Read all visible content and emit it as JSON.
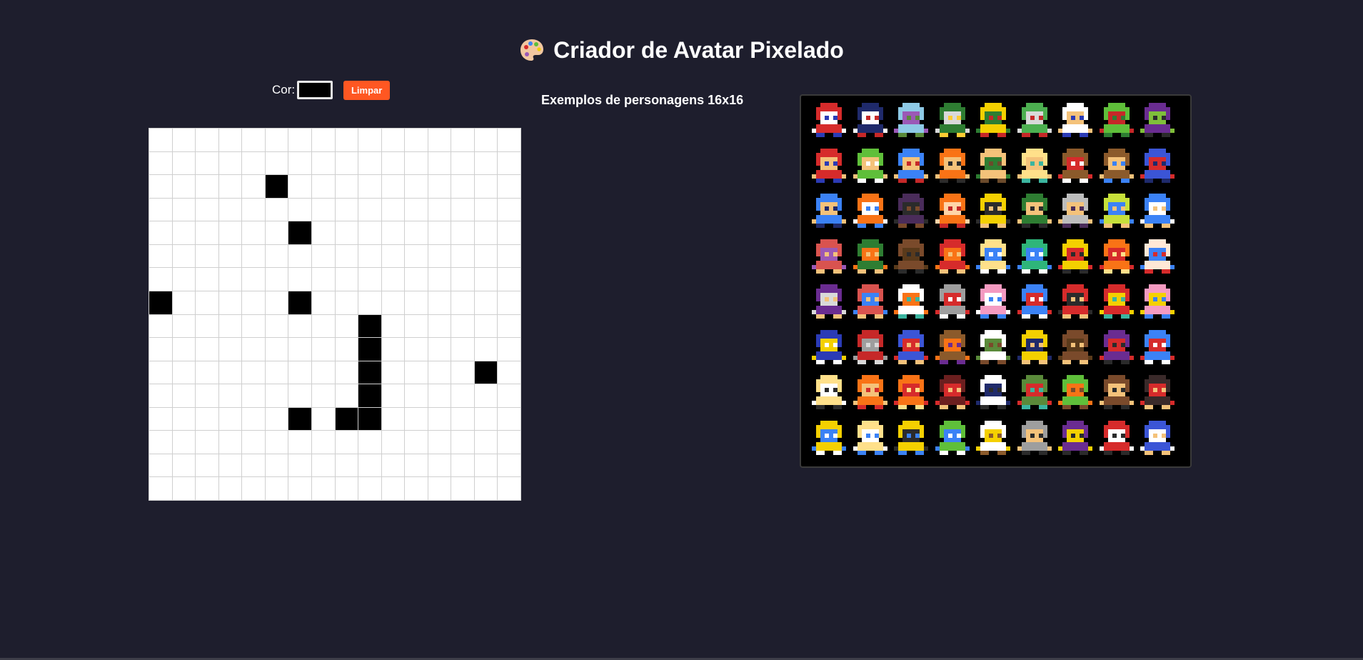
{
  "header": {
    "title": "Criador de Avatar Pixelado",
    "icon": "palette-icon"
  },
  "toolbar": {
    "color_label": "Cor:",
    "color_value": "#000000",
    "clear_label": "Limpar",
    "clear_color": "#ff5722"
  },
  "editor": {
    "grid_size": 16,
    "filled_color": "#000000",
    "filled_cells": [
      [
        2,
        5
      ],
      [
        4,
        6
      ],
      [
        7,
        0
      ],
      [
        7,
        6
      ],
      [
        8,
        9
      ],
      [
        9,
        9
      ],
      [
        10,
        9
      ],
      [
        10,
        14
      ],
      [
        11,
        9
      ],
      [
        12,
        6
      ],
      [
        12,
        8
      ],
      [
        12,
        9
      ]
    ]
  },
  "examples": {
    "heading": "Exemplos de personagens 16x16",
    "sprites": [
      {
        "name": "sprite-red-masked-hero",
        "colors": [
          "#d62b2b",
          "#ffffff",
          "#2b3bb5"
        ]
      },
      {
        "name": "sprite-dark-masked-hero",
        "colors": [
          "#1f2a6b",
          "#ffffff",
          "#c62828"
        ]
      },
      {
        "name": "sprite-purple-haired-character",
        "colors": [
          "#8ecae6",
          "#9b59b6",
          "#5a8a3a"
        ]
      },
      {
        "name": "sprite-swordsman",
        "colors": [
          "#2e7d32",
          "#d9d9d9",
          "#ffcc33"
        ]
      },
      {
        "name": "sprite-yellow-robot",
        "colors": [
          "#f4d000",
          "#2e7d32",
          "#c62828"
        ]
      },
      {
        "name": "sprite-green-goblin",
        "colors": [
          "#4caf50",
          "#d9d9d9",
          "#c62828"
        ]
      },
      {
        "name": "sprite-chef",
        "colors": [
          "#ffffff",
          "#f4c27a",
          "#2b3bb5"
        ]
      },
      {
        "name": "sprite-green-lizard",
        "colors": [
          "#5fbf3a",
          "#c62828",
          "#2e7d32"
        ]
      },
      {
        "name": "sprite-purple-witch",
        "colors": [
          "#6a2c91",
          "#7fbf3a",
          "#2b2b2b"
        ]
      },
      {
        "name": "sprite-red-cap-boy",
        "colors": [
          "#d62b2b",
          "#f4c27a",
          "#2b3bb5"
        ]
      },
      {
        "name": "sprite-green-cap-boy",
        "colors": [
          "#5fbf3a",
          "#f4c27a",
          "#ffffff"
        ]
      },
      {
        "name": "sprite-blue-beanie-boy",
        "colors": [
          "#3b82f6",
          "#f4c27a",
          "#c62828"
        ]
      },
      {
        "name": "sprite-orange-hood-boy",
        "colors": [
          "#f97316",
          "#f4c27a",
          "#2b2b2b"
        ]
      },
      {
        "name": "sprite-bald-man",
        "colors": [
          "#f4c27a",
          "#2e7d32",
          "#6b4a2b"
        ]
      },
      {
        "name": "sprite-blond-boy",
        "colors": [
          "#ffe08a",
          "#f4c27a",
          "#3bb5a0"
        ]
      },
      {
        "name": "sprite-stick-figure",
        "colors": [
          "#8b5a2b",
          "#d62b2b",
          "#ffffff"
        ]
      },
      {
        "name": "sprite-cowboy-boy",
        "colors": [
          "#8b5a2b",
          "#f4c27a",
          "#3b82f6"
        ]
      },
      {
        "name": "sprite-blue-ghost",
        "colors": [
          "#3b55d6",
          "#d62b2b",
          "#1f2a6b"
        ]
      },
      {
        "name": "sprite-blue-ninja",
        "colors": [
          "#3b82f6",
          "#f4c27a",
          "#1f2a6b"
        ]
      },
      {
        "name": "sprite-orange-hat-explorer",
        "colors": [
          "#f97316",
          "#ffffff",
          "#3b82f6"
        ]
      },
      {
        "name": "sprite-dark-warrior",
        "colors": [
          "#4a2c5a",
          "#2b2b2b",
          "#7a4a2b"
        ]
      },
      {
        "name": "sprite-orange-fighter",
        "colors": [
          "#f97316",
          "#ffd4a8",
          "#c62828"
        ]
      },
      {
        "name": "sprite-yellow-fighter",
        "colors": [
          "#f4d000",
          "#2b2b2b",
          "#f4c27a"
        ]
      },
      {
        "name": "sprite-green-soldier",
        "colors": [
          "#2e7d32",
          "#f4c27a",
          "#2b2b2b"
        ]
      },
      {
        "name": "sprite-hat-gunslinger",
        "colors": [
          "#bdbdbd",
          "#f4c27a",
          "#4a2c5a"
        ]
      },
      {
        "name": "sprite-green-elf",
        "colors": [
          "#c6e03a",
          "#3b82f6",
          "#f4c27a"
        ]
      },
      {
        "name": "sprite-blue-martial-artist",
        "colors": [
          "#3b82f6",
          "#ffffff",
          "#f4c27a"
        ]
      },
      {
        "name": "sprite-red-haired-girl",
        "colors": [
          "#d9534f",
          "#9b59b6",
          "#f4c27a"
        ]
      },
      {
        "name": "sprite-green-archer",
        "colors": [
          "#2e7d32",
          "#f97316",
          "#f4c27a"
        ]
      },
      {
        "name": "sprite-brown-dog",
        "colors": [
          "#7a4a2b",
          "#5a3a1b",
          "#2b2b2b"
        ]
      },
      {
        "name": "sprite-red-head-beast",
        "colors": [
          "#d62b2b",
          "#f97316",
          "#f4c27a"
        ]
      },
      {
        "name": "sprite-blond-hero",
        "colors": [
          "#ffe08a",
          "#3b82f6",
          "#ffffff"
        ]
      },
      {
        "name": "sprite-green-dino",
        "colors": [
          "#2eb57a",
          "#3b82f6",
          "#ffffff"
        ]
      },
      {
        "name": "sprite-yellow-mouse",
        "colors": [
          "#f4d000",
          "#d62b2b",
          "#2b2b2b"
        ]
      },
      {
        "name": "sprite-orange-fox",
        "colors": [
          "#f97316",
          "#d62b2b",
          "#ffe08a"
        ]
      },
      {
        "name": "sprite-white-cat",
        "colors": [
          "#ffe8d6",
          "#3b82f6",
          "#d62b2b"
        ]
      },
      {
        "name": "sprite-purple-dress-girl",
        "colors": [
          "#6a2c91",
          "#d9d9d9",
          "#f4c27a"
        ]
      },
      {
        "name": "sprite-redhead-fighter",
        "colors": [
          "#d9534f",
          "#3b82f6",
          "#f4c27a"
        ]
      },
      {
        "name": "sprite-white-goose",
        "colors": [
          "#ffffff",
          "#f97316",
          "#3bb5a0"
        ]
      },
      {
        "name": "sprite-gray-bird",
        "colors": [
          "#9e9e9e",
          "#d62b2b",
          "#ffffff"
        ]
      },
      {
        "name": "sprite-pink-bunny",
        "colors": [
          "#f49ac1",
          "#ffffff",
          "#3b82f6"
        ]
      },
      {
        "name": "sprite-blue-red-robot",
        "colors": [
          "#3b82f6",
          "#d62b2b",
          "#ffffff"
        ]
      },
      {
        "name": "sprite-red-hooded-hero",
        "colors": [
          "#d62b2b",
          "#2b2b2b",
          "#f4c27a"
        ]
      },
      {
        "name": "sprite-red-yellow-runner",
        "colors": [
          "#d62b2b",
          "#f4d000",
          "#3bb5a0"
        ]
      },
      {
        "name": "sprite-pink-yellow-girl",
        "colors": [
          "#f49ac1",
          "#f4d000",
          "#3b82f6"
        ]
      },
      {
        "name": "sprite-dark-cat-knight",
        "colors": [
          "#2b3bb5",
          "#f4d000",
          "#ffffff"
        ]
      },
      {
        "name": "sprite-red-devil",
        "colors": [
          "#c62828",
          "#9e9e9e",
          "#d9d9d9"
        ]
      },
      {
        "name": "sprite-blue-mage",
        "colors": [
          "#3b55d6",
          "#d62b2b",
          "#f4c27a"
        ]
      },
      {
        "name": "sprite-brown-witch",
        "colors": [
          "#8b5a2b",
          "#f97316",
          "#6a2c91"
        ]
      },
      {
        "name": "sprite-white-bearded-elder",
        "colors": [
          "#ffffff",
          "#5a8a3a",
          "#7a4a2b"
        ]
      },
      {
        "name": "sprite-yellow-suit-kid",
        "colors": [
          "#f4d000",
          "#1f2a6b",
          "#f4c27a"
        ]
      },
      {
        "name": "sprite-brown-bear",
        "colors": [
          "#7a4a2b",
          "#5a3a1b",
          "#f4c27a"
        ]
      },
      {
        "name": "sprite-purple-caped-villain",
        "colors": [
          "#6a2c91",
          "#d62b2b",
          "#2b2b2b"
        ]
      },
      {
        "name": "sprite-red-blue-hero",
        "colors": [
          "#3b82f6",
          "#d62b2b",
          "#ffffff"
        ]
      },
      {
        "name": "sprite-blond-student",
        "colors": [
          "#ffe08a",
          "#ffffff",
          "#2b2b2b"
        ]
      },
      {
        "name": "sprite-orange-haired-girl",
        "colors": [
          "#f97316",
          "#f4c27a",
          "#d62b2b"
        ]
      },
      {
        "name": "sprite-orange-bob-girl",
        "colors": [
          "#f97316",
          "#d62b2b",
          "#ffe08a"
        ]
      },
      {
        "name": "sprite-dark-haired-girl",
        "colors": [
          "#6b1f1f",
          "#d62b2b",
          "#f4c27a"
        ]
      },
      {
        "name": "sprite-masked-killer",
        "colors": [
          "#ffffff",
          "#1f2a6b",
          "#2b2b2b"
        ]
      },
      {
        "name": "sprite-green-zombie",
        "colors": [
          "#5a8a3a",
          "#d62b2b",
          "#3bb5a0"
        ]
      },
      {
        "name": "sprite-green-orc",
        "colors": [
          "#5fbf3a",
          "#f97316",
          "#7a4a2b"
        ]
      },
      {
        "name": "sprite-long-haired-woman",
        "colors": [
          "#7a4a2b",
          "#f4c27a",
          "#2b2b2b"
        ]
      },
      {
        "name": "sprite-dark-suit-man",
        "colors": [
          "#3a2a2a",
          "#d62b2b",
          "#f4c27a"
        ]
      },
      {
        "name": "sprite-yellow-blue-fish",
        "colors": [
          "#f4d000",
          "#3b82f6",
          "#ffffff"
        ]
      },
      {
        "name": "sprite-yellow-kid",
        "colors": [
          "#ffe08a",
          "#ffffff",
          "#3b82f6"
        ]
      },
      {
        "name": "sprite-yellow-boy",
        "colors": [
          "#f4d000",
          "#2b2b2b",
          "#3b82f6"
        ]
      },
      {
        "name": "sprite-green-alien",
        "colors": [
          "#5fbf3a",
          "#3b82f6",
          "#ffffff"
        ]
      },
      {
        "name": "sprite-white-duck",
        "colors": [
          "#ffffff",
          "#f4d000",
          "#8b5a2b"
        ]
      },
      {
        "name": "sprite-gray-rogue",
        "colors": [
          "#9e9e9e",
          "#f4c27a",
          "#2b2b2b"
        ]
      },
      {
        "name": "sprite-purple-dragon",
        "colors": [
          "#6a2c91",
          "#f4d000",
          "#2b2b2b"
        ]
      },
      {
        "name": "sprite-red-kunoichi",
        "colors": [
          "#d62b2b",
          "#ffffff",
          "#2b2b2b"
        ]
      },
      {
        "name": "sprite-blue-hedgehog",
        "colors": [
          "#3b55d6",
          "#ffffff",
          "#f4c27a"
        ]
      }
    ]
  }
}
